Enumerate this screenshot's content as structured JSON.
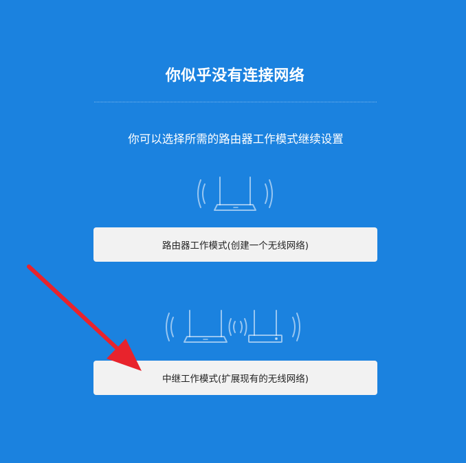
{
  "page": {
    "title": "你似乎没有连接网络",
    "subtitle": "你可以选择所需的路由器工作模式继续设置"
  },
  "modes": [
    {
      "label": "路由器工作模式(创建一个无线网络)",
      "illustration": "single-router-wifi-icon"
    },
    {
      "label": "中继工作模式(扩展现有的无线网络)",
      "illustration": "repeater-routers-wifi-icon"
    }
  ],
  "colors": {
    "background": "#1b82df",
    "button_bg": "#f2f2f2",
    "button_text": "#222222",
    "annotation_arrow": "#e8232c"
  }
}
